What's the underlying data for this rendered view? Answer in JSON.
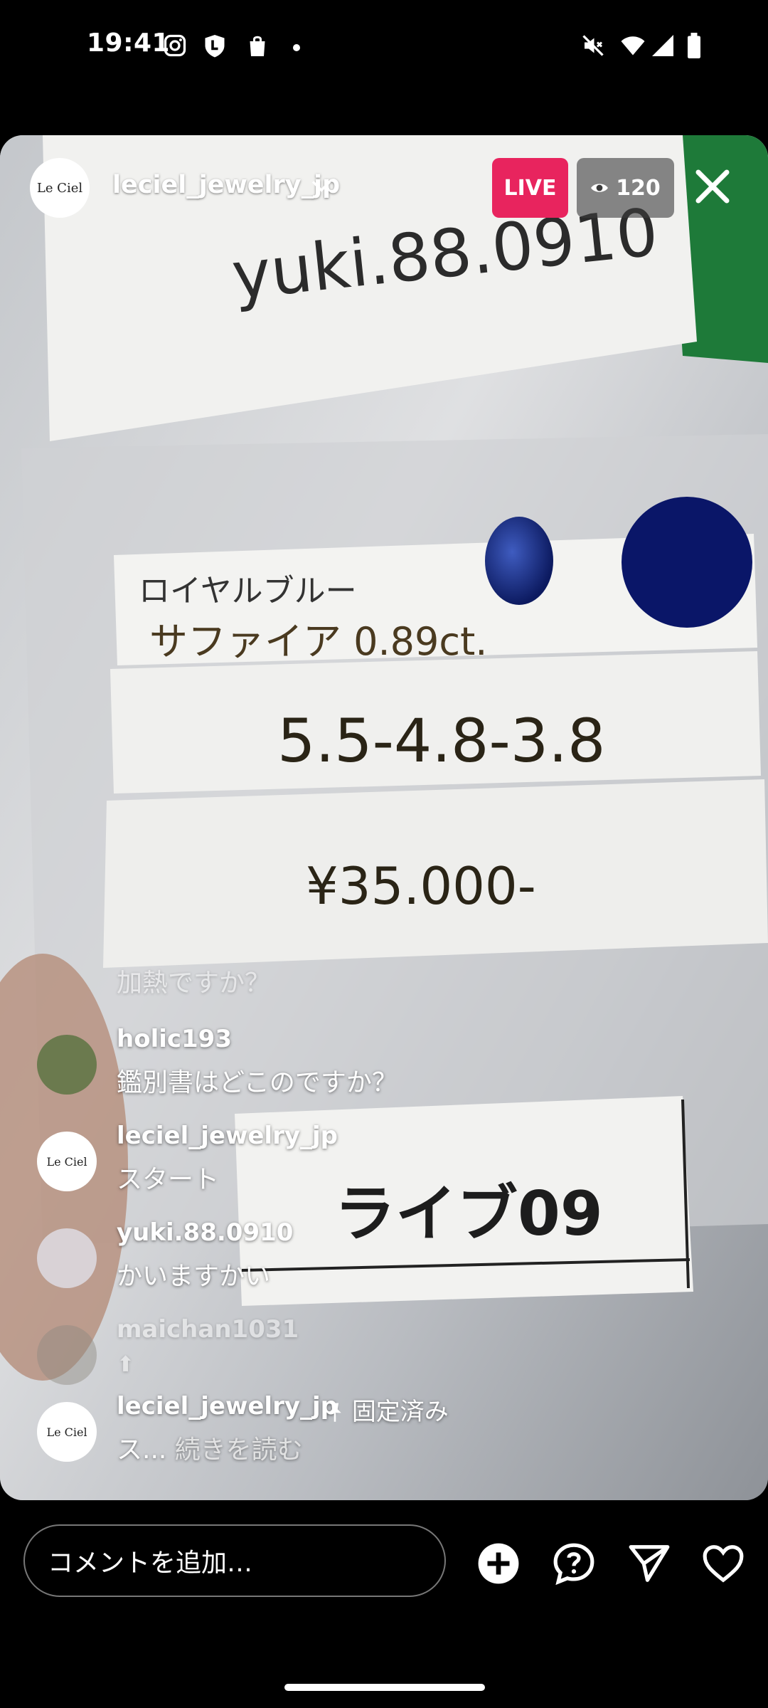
{
  "status_bar": {
    "time": "19:41",
    "left_icons": [
      "instagram-icon",
      "shield-l-icon",
      "shopping-bag-icon",
      "dot-icon"
    ],
    "right_icons": [
      "mute-icon",
      "wifi-icon",
      "signal-icon",
      "battery-icon"
    ]
  },
  "live": {
    "host": {
      "name": "leciel_jewelry_jp",
      "avatar_text": "Le Ciel"
    },
    "badge": "LIVE",
    "viewer_count": "120",
    "video_text": {
      "note_top": "yuki.88.0910",
      "line1": "ロイヤルブルー",
      "line2": "サファイア 0.89ct.",
      "dims": "5.5-4.8-3.8",
      "price": "¥35.000-",
      "card": "ライブ09"
    }
  },
  "comments": [
    {
      "user": "",
      "text": "加熱ですか？",
      "faded": true
    },
    {
      "user": "holic193",
      "text": "鑑別書はどこのですか？",
      "faded": false
    },
    {
      "user": "leciel_jewelry_jp",
      "text": "スタート",
      "faded": false
    },
    {
      "user": "yuki.88.0910",
      "text": "かいますかい",
      "faded": false
    },
    {
      "user": "maichan1031",
      "text": "⬆",
      "faded": true
    },
    {
      "user": "leciel_jewelry_jp",
      "pinned_label": "固定済み",
      "text": "ス...",
      "readmore": "続きを読む",
      "faded": false
    }
  ],
  "bottom_bar": {
    "comment_placeholder": "コメントを追加…",
    "icons": [
      "add-icon",
      "question-icon",
      "send-icon",
      "heart-icon"
    ]
  }
}
